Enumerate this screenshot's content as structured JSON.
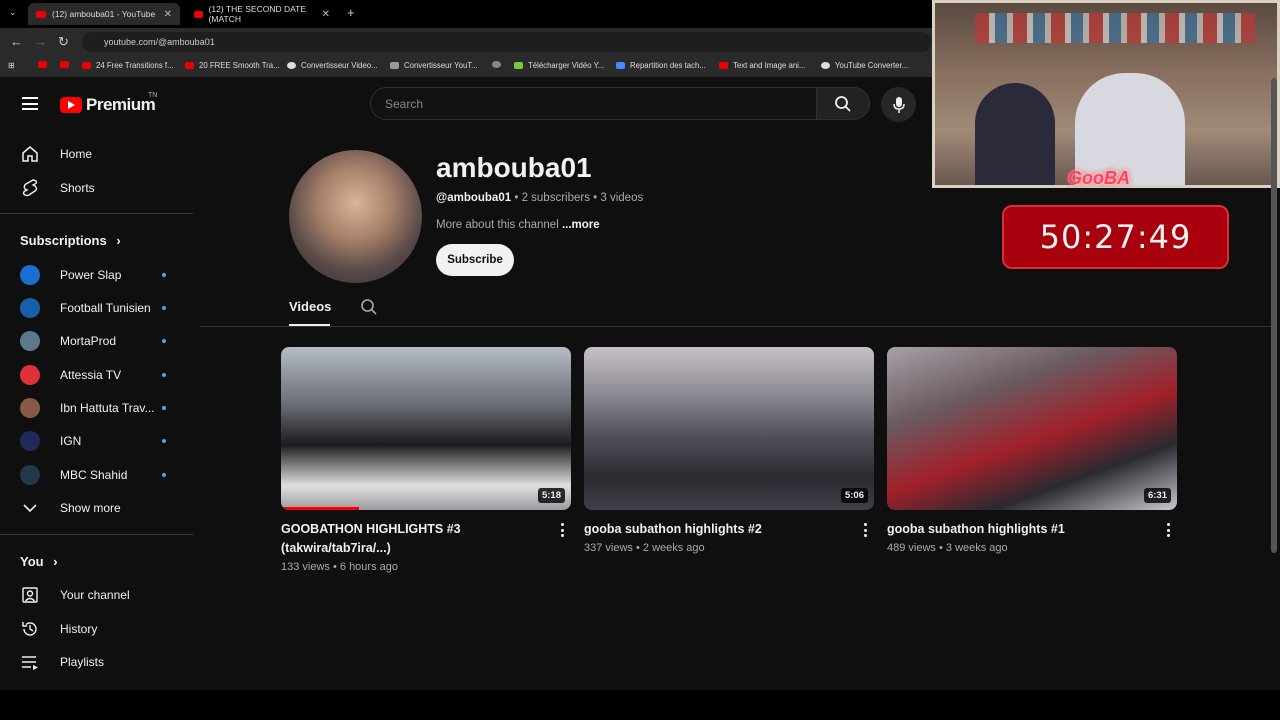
{
  "browser": {
    "tabs": [
      {
        "label": "(12) ambouba01 - YouTube",
        "active": true
      },
      {
        "label": "(12) THE SECOND DATE (MATCH",
        "active": false
      }
    ],
    "url": "youtube.com/@ambouba01",
    "bookmarks": [
      "24 Free Transitions f...",
      "20 FREE Smooth Tra...",
      "Convertisseur Video...",
      "Convertisseur YouT...",
      "Télécharger Vidéo Y...",
      "Repartition des tach...",
      "Text and Image ani...",
      "YouTube Converter..."
    ]
  },
  "header": {
    "logo_text": "Premium",
    "logo_region": "TN",
    "search_placeholder": "Search"
  },
  "sidebar": {
    "main": [
      {
        "label": "Home",
        "icon": "home-icon"
      },
      {
        "label": "Shorts",
        "icon": "shorts-icon"
      }
    ],
    "subscriptions_title": "Subscriptions",
    "subscriptions": [
      {
        "label": "Power Slap",
        "color": "#1a6fd0"
      },
      {
        "label": "Football Tunisien",
        "color": "#1560a8"
      },
      {
        "label": "MortaProd",
        "color": "#5a7a8a"
      },
      {
        "label": "Attessia TV",
        "color": "#e0303a"
      },
      {
        "label": "Ibn Hattuta Trav...",
        "color": "#8a5a48"
      },
      {
        "label": "IGN",
        "color": "#1f2a5a"
      },
      {
        "label": "MBC Shahid",
        "color": "#203848"
      }
    ],
    "show_more": "Show more",
    "you_title": "You",
    "you": [
      {
        "label": "Your channel",
        "icon": "user-icon"
      },
      {
        "label": "History",
        "icon": "history-icon"
      },
      {
        "label": "Playlists",
        "icon": "playlists-icon"
      }
    ]
  },
  "channel": {
    "name": "ambouba01",
    "handle": "@ambouba01",
    "subscribers": "2 subscribers",
    "videos_count": "3 videos",
    "about": "More about this channel",
    "more": "...more",
    "subscribe": "Subscribe",
    "tab_videos": "Videos"
  },
  "videos": [
    {
      "title": "GOOBATHON HIGHLIGHTS #3 (takwira/tab7ira/...)",
      "views": "133 views",
      "age": "6 hours ago",
      "duration": "5:18",
      "watched": 0.27
    },
    {
      "title": "gooba subathon highlights #2",
      "views": "337 views",
      "age": "2 weeks ago",
      "duration": "5:06",
      "watched": 0
    },
    {
      "title": "gooba subathon highlights #1",
      "views": "489 views",
      "age": "3 weeks ago",
      "duration": "6:31",
      "watched": 0
    }
  ],
  "stream_overlay": {
    "tag": "GooBA",
    "timer": "50:27:49"
  }
}
